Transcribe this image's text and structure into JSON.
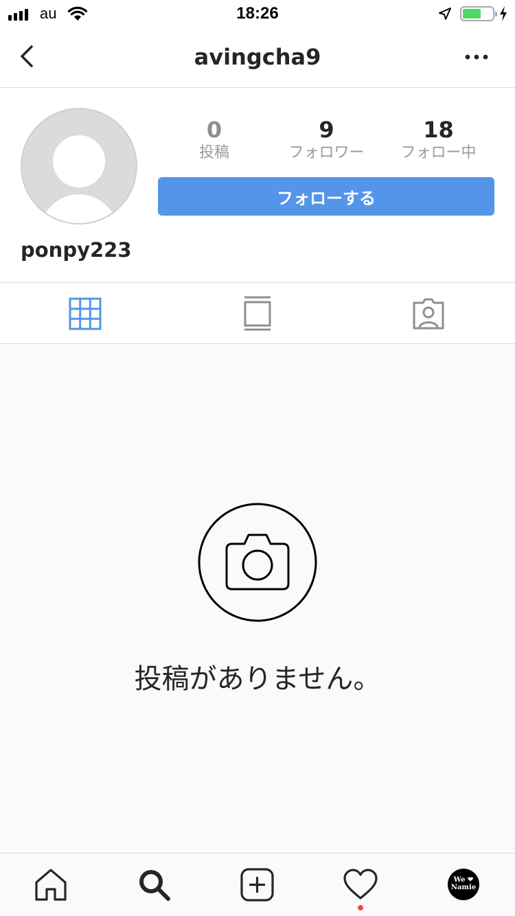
{
  "status_bar": {
    "carrier": "au",
    "time": "18:26",
    "battery_level": 0.62,
    "battery_color": "#4cd964"
  },
  "nav": {
    "title": "avingcha9",
    "back_icon": "chevron-left-icon",
    "more_icon": "more-horizontal-icon"
  },
  "profile": {
    "username": "ponpy223",
    "stats": [
      {
        "value": "0",
        "label": "投稿"
      },
      {
        "value": "9",
        "label": "フォロワー"
      },
      {
        "value": "18",
        "label": "フォロー中"
      }
    ],
    "follow_button_label": "フォローする",
    "accent_color": "#5395e8"
  },
  "tabs": [
    {
      "icon": "grid-icon",
      "active": true
    },
    {
      "icon": "feed-icon",
      "active": false
    },
    {
      "icon": "tagged-person-icon",
      "active": false
    }
  ],
  "empty_state": {
    "icon": "camera-icon",
    "message": "投稿がありません。"
  },
  "tab_bar": {
    "items": [
      "home-icon",
      "search-icon",
      "add-post-icon",
      "activity-heart-icon",
      "profile-avatar"
    ],
    "avatar_text_top": "We ❤",
    "avatar_text_bottom": "Namie",
    "notification_dot_color": "#ed4956"
  }
}
